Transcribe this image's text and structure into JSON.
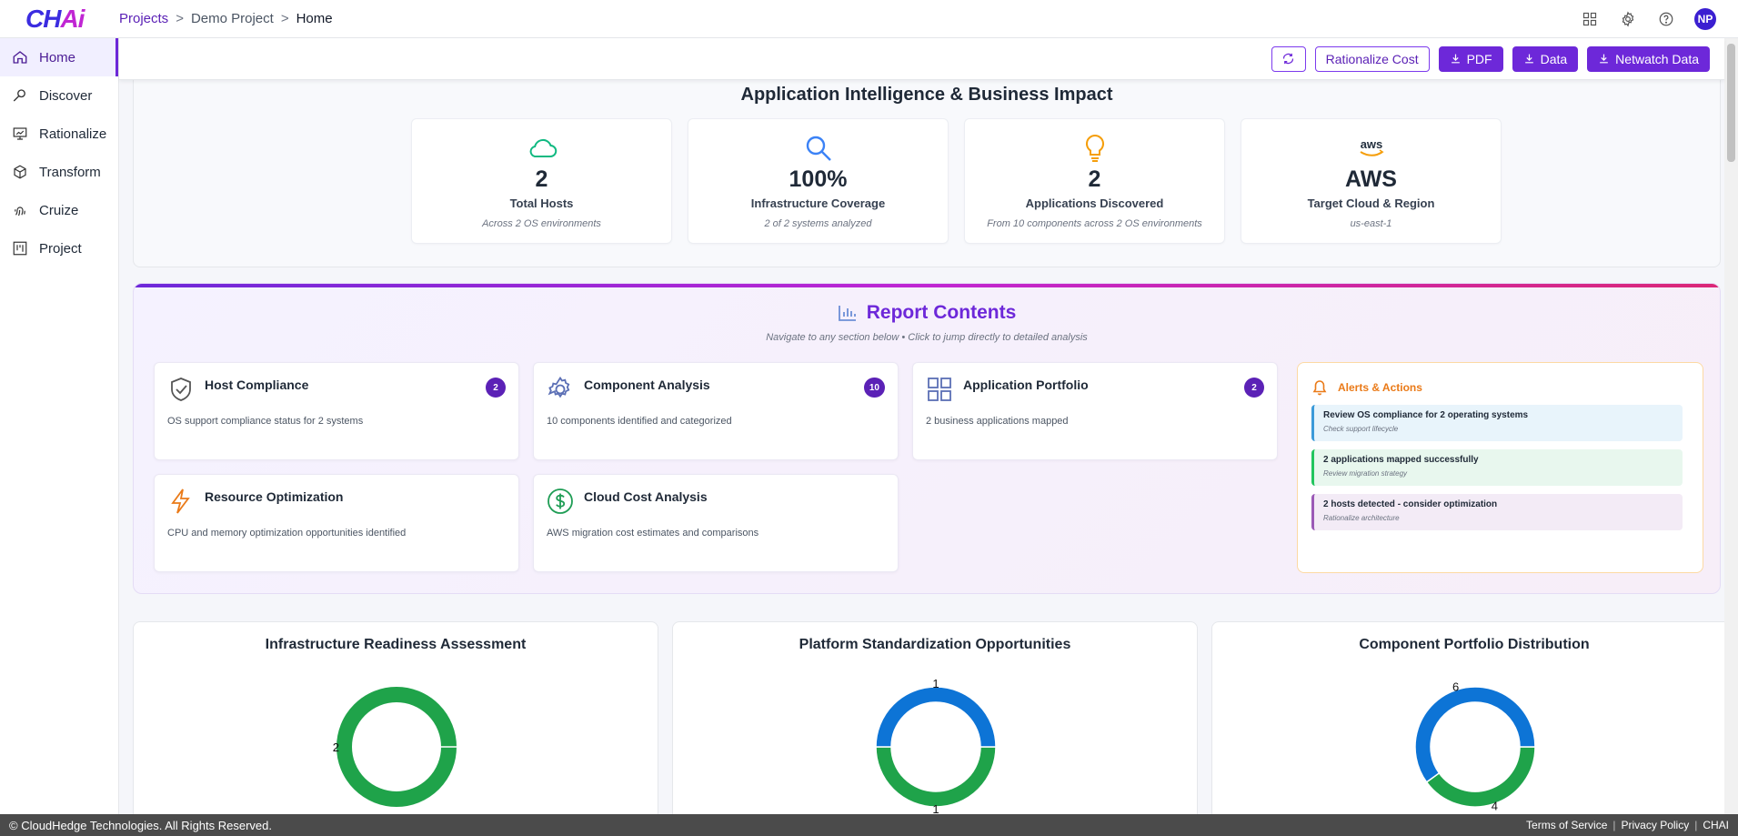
{
  "app": {
    "logo_a": "CH",
    "logo_b": "Ai"
  },
  "breadcrumb": {
    "projects": "Projects",
    "project": "Demo Project",
    "current": "Home",
    "sep": ">"
  },
  "header": {
    "avatar_initials": "NP"
  },
  "sidebar": {
    "items": [
      {
        "label": "Home",
        "active": true
      },
      {
        "label": "Discover"
      },
      {
        "label": "Rationalize"
      },
      {
        "label": "Transform"
      },
      {
        "label": "Cruize"
      },
      {
        "label": "Project"
      }
    ]
  },
  "toolbar": {
    "rationalize_label": "Rationalize Cost",
    "pdf_label": "PDF",
    "data_label": "Data",
    "netwatch_label": "Netwatch Data"
  },
  "intel": {
    "title": "Application Intelligence & Business Impact",
    "metrics": [
      {
        "icon": "cloud-icon",
        "value": "2",
        "label": "Total Hosts",
        "sub": "Across 2 OS environments",
        "color": "#10b981"
      },
      {
        "icon": "search-icon",
        "value": "100%",
        "label": "Infrastructure Coverage",
        "sub": "2 of 2 systems analyzed",
        "color": "#3b82f6"
      },
      {
        "icon": "lightbulb-icon",
        "value": "2",
        "label": "Applications Discovered",
        "sub": "From 10 components across 2 OS environments",
        "color": "#f59e0b"
      },
      {
        "icon": "aws-logo",
        "value": "AWS",
        "label": "Target Cloud & Region",
        "sub": "us-east-1",
        "logo_text": "aws"
      }
    ]
  },
  "report": {
    "title": "Report Contents",
    "subtitle": "Navigate to any section below • Click to jump directly to detailed analysis",
    "cards": [
      {
        "icon": "shield-check-icon",
        "title": "Host Compliance",
        "desc": "OS support compliance status for 2 systems",
        "badge": "2"
      },
      {
        "icon": "gear-icon",
        "title": "Component Analysis",
        "desc": "10 components identified and categorized",
        "badge": "10"
      },
      {
        "icon": "grid-icon",
        "title": "Application Portfolio",
        "desc": "2 business applications mapped",
        "badge": "2"
      },
      {
        "icon": "lightning-icon",
        "title": "Resource Optimization",
        "desc": "CPU and memory optimization opportunities identified"
      },
      {
        "icon": "dollar-icon",
        "title": "Cloud Cost Analysis",
        "desc": "AWS migration cost estimates and comparisons"
      }
    ],
    "alerts": {
      "title": "Alerts & Actions",
      "items": [
        {
          "title": "Review OS compliance for 2 operating systems",
          "sub": "Check support lifecycle",
          "bg": "#e8f4fb",
          "border": "#3b9ad9"
        },
        {
          "title": "2 applications mapped successfully",
          "sub": "Review migration strategy",
          "bg": "#e8f7ee",
          "border": "#22c55e"
        },
        {
          "title": "2 hosts detected - consider optimization",
          "sub": "Rationalize architecture",
          "bg": "#f3ebf6",
          "border": "#9b59b6"
        }
      ]
    }
  },
  "chart_data": [
    {
      "type": "donut",
      "title": "Infrastructure Readiness Assessment",
      "series": [
        {
          "value": 2,
          "color": "#1fa34a"
        }
      ]
    },
    {
      "type": "donut",
      "title": "Platform Standardization Opportunities",
      "series": [
        {
          "value": 1,
          "color": "#1fa34a"
        },
        {
          "value": 1,
          "color": "#0d74d6"
        }
      ]
    },
    {
      "type": "donut",
      "title": "Component Portfolio Distribution",
      "series": [
        {
          "value": 4,
          "color": "#1fa34a"
        },
        {
          "value": 6,
          "color": "#0d74d6"
        }
      ]
    }
  ],
  "footer": {
    "copyright": "© CloudHedge Technologies. All Rights Reserved.",
    "terms": "Terms of Service",
    "privacy": "Privacy Policy",
    "brand": "CHAI",
    "pipe": "|"
  }
}
